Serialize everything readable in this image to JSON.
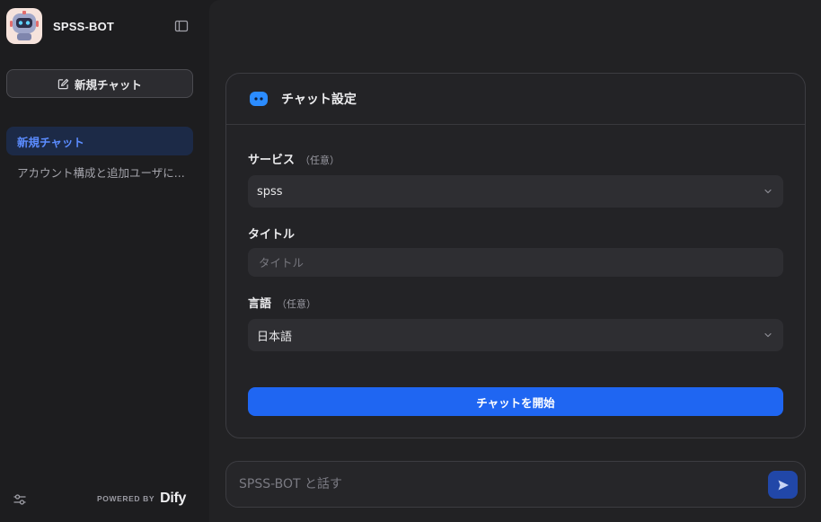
{
  "app": {
    "name": "SPSS-BOT"
  },
  "sidebar": {
    "new_chat_label": "新規チャット",
    "conversations": [
      {
        "label": "新規チャット",
        "active": true
      },
      {
        "label": "アカウント構成と追加ユーザに..."
      }
    ],
    "powered_by_label": "POWERED BY",
    "powered_by_brand": "Dify"
  },
  "card": {
    "title": "チャット設定",
    "fields": {
      "service": {
        "label": "サービス",
        "optional": "（任意）",
        "value": "spss"
      },
      "title": {
        "label": "タイトル",
        "placeholder": "タイトル",
        "value": ""
      },
      "language": {
        "label": "言語",
        "optional": "（任意）",
        "value": "日本語"
      }
    },
    "start_button_label": "チャットを開始"
  },
  "chat": {
    "placeholder": "SPSS-BOT と話す"
  },
  "colors": {
    "accent": "#1f66f2",
    "active_item": "#5b8cff",
    "send_button": "#2147a8"
  }
}
